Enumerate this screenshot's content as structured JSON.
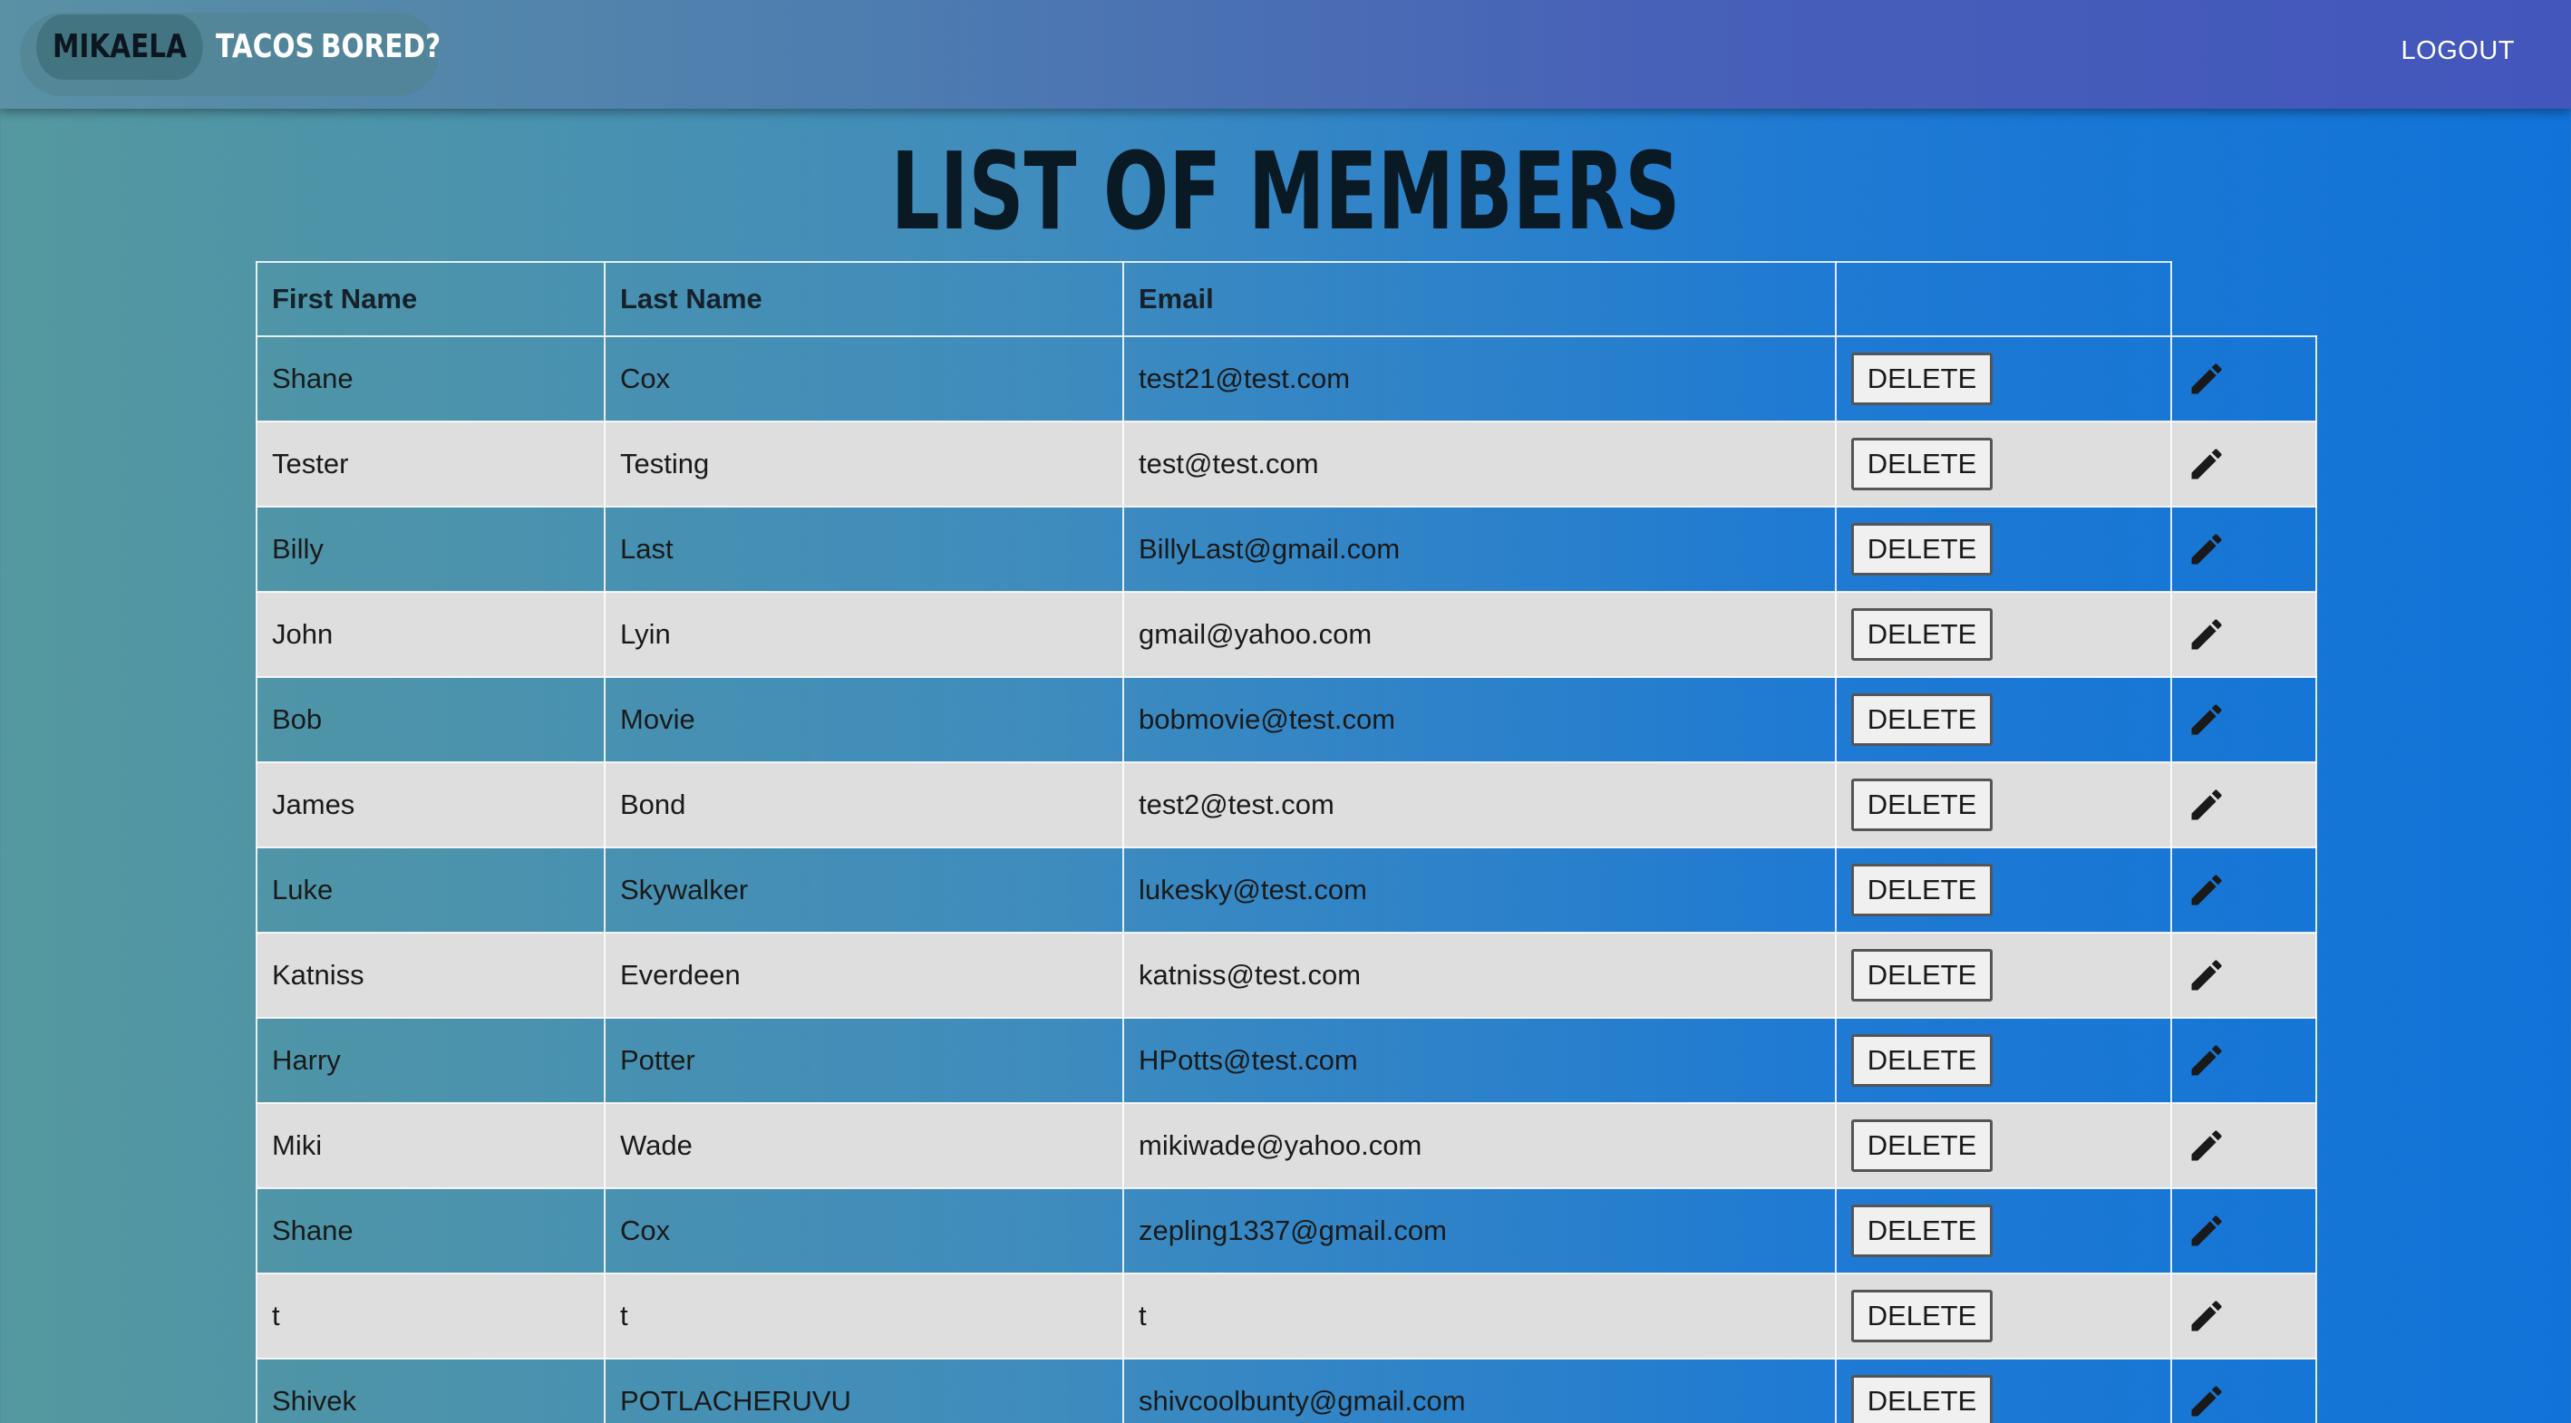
{
  "nav": {
    "brand": "Mikaela",
    "links": [
      "Tacos",
      "Bored?"
    ],
    "logout": "LOGOUT"
  },
  "page_title": "List of Members",
  "table": {
    "headers": [
      "First Name",
      "Last Name",
      "Email"
    ],
    "delete_label": "DELETE",
    "edit_icon": "pencil-icon",
    "rows": [
      {
        "first": "Shane",
        "last": "Cox",
        "email": "test21@test.com"
      },
      {
        "first": "Tester",
        "last": "Testing",
        "email": "test@test.com"
      },
      {
        "first": "Billy",
        "last": "Last",
        "email": "BillyLast@gmail.com"
      },
      {
        "first": "John",
        "last": "Lyin",
        "email": "gmail@yahoo.com"
      },
      {
        "first": "Bob",
        "last": "Movie",
        "email": "bobmovie@test.com"
      },
      {
        "first": "James",
        "last": "Bond",
        "email": "test2@test.com"
      },
      {
        "first": "Luke",
        "last": "Skywalker",
        "email": "lukesky@test.com"
      },
      {
        "first": "Katniss",
        "last": "Everdeen",
        "email": "katniss@test.com"
      },
      {
        "first": "Harry",
        "last": "Potter",
        "email": "HPotts@test.com"
      },
      {
        "first": "Miki",
        "last": "Wade",
        "email": "mikiwade@yahoo.com"
      },
      {
        "first": "Shane",
        "last": "Cox",
        "email": "zepling1337@gmail.com"
      },
      {
        "first": "t",
        "last": "t",
        "email": "t"
      },
      {
        "first": "Shivek",
        "last": "POTLACHERUVU",
        "email": "shivcoolbunty@gmail.com"
      }
    ]
  }
}
